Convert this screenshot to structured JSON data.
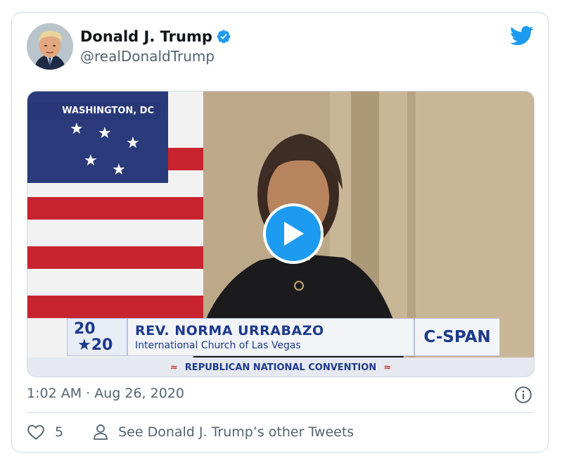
{
  "author": {
    "name": "Donald J. Trump",
    "handle": "@realDonaldTrump"
  },
  "media": {
    "location": "WASHINGTON, DC",
    "logo_line1": "20",
    "logo_line2": "★20",
    "lower_third_name": "REV. NORMA URRABAZO",
    "lower_third_subtitle": "International Church of Las Vegas",
    "network": "C-SPAN",
    "banner": "REPUBLICAN NATIONAL CONVENTION"
  },
  "tweet": {
    "timestamp": "1:02 AM · Aug 26, 2020",
    "like_count": "5",
    "other_tweets_label": "See Donald J. Trump’s other Tweets"
  },
  "colors": {
    "accent": "#1d9bf0",
    "muted_text": "#536471",
    "border": "#cfd9de"
  },
  "icons": [
    "verified-badge-icon",
    "twitter-bird-icon",
    "play-icon",
    "info-icon",
    "heart-icon",
    "person-icon"
  ]
}
